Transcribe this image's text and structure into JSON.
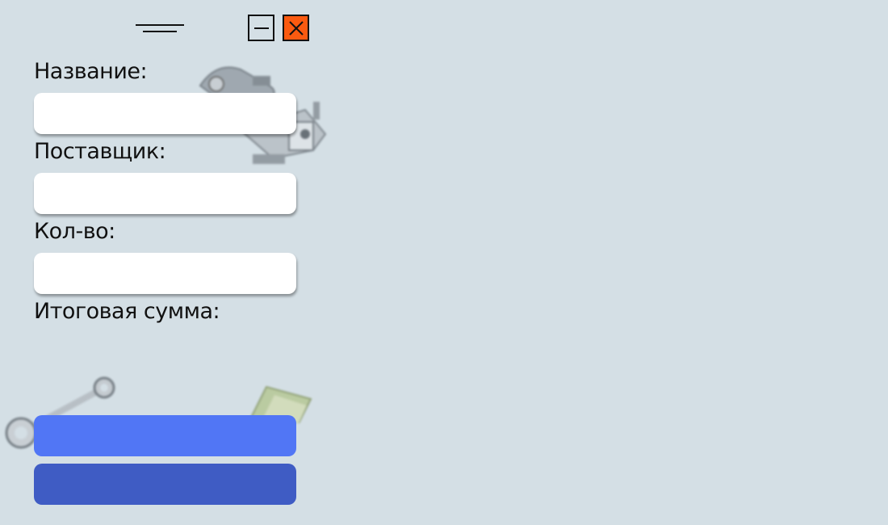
{
  "window": {
    "controls": {
      "drag_icon": "drag-handle-icon",
      "minimize_icon": "minimize-icon",
      "close_icon": "close-icon",
      "close_color": "#fa5a10"
    }
  },
  "form": {
    "name_label": "Название:",
    "name_value": "",
    "supplier_label": "Поставщик:",
    "supplier_value": "",
    "quantity_label": "Кол-во:",
    "quantity_value": "",
    "total_label": "Итоговая сумма:",
    "total_value": ""
  },
  "buttons": {
    "primary_label": "",
    "primary_color": "#5176f5",
    "secondary_label": "",
    "secondary_color": "#3f5cc4"
  },
  "decorations": {
    "tools_image": "tools-illustration",
    "wrench_image": "wrench-illustration",
    "money_image": "money-illustration"
  }
}
